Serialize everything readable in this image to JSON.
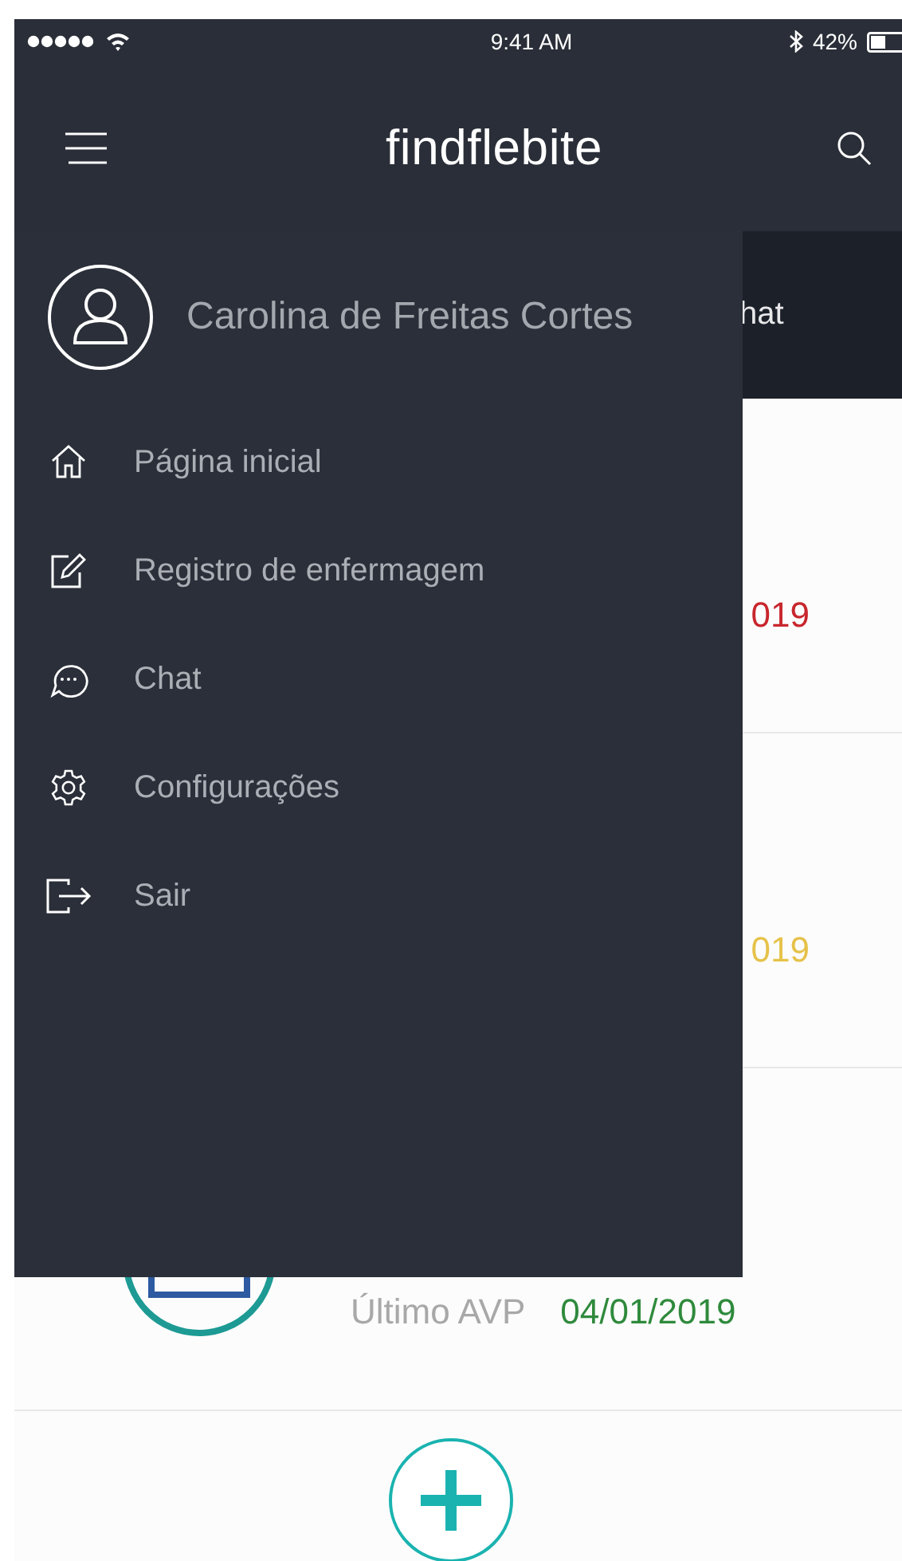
{
  "status_bar": {
    "time": "9:41 AM",
    "battery": "42%"
  },
  "header": {
    "title": "findflebite"
  },
  "tab_bar": {
    "visible_label": "hat"
  },
  "records": [
    {
      "date": "019",
      "color": "#c8262d"
    },
    {
      "date": "019",
      "color": "#e6c24a"
    },
    {
      "label": "Último AVP",
      "date": "04/01/2019",
      "color": "#2f8a3c",
      "kind": "picture"
    }
  ],
  "drawer": {
    "user_name": "Carolina de Freitas Cortes",
    "items": [
      {
        "label": "Página inicial",
        "kind": "home"
      },
      {
        "label": "Registro de enfermagem",
        "kind": "edit"
      },
      {
        "label": "Chat",
        "kind": "chat"
      },
      {
        "label": "Configurações",
        "kind": "settings"
      },
      {
        "label": "Sair",
        "kind": "logout"
      }
    ]
  }
}
